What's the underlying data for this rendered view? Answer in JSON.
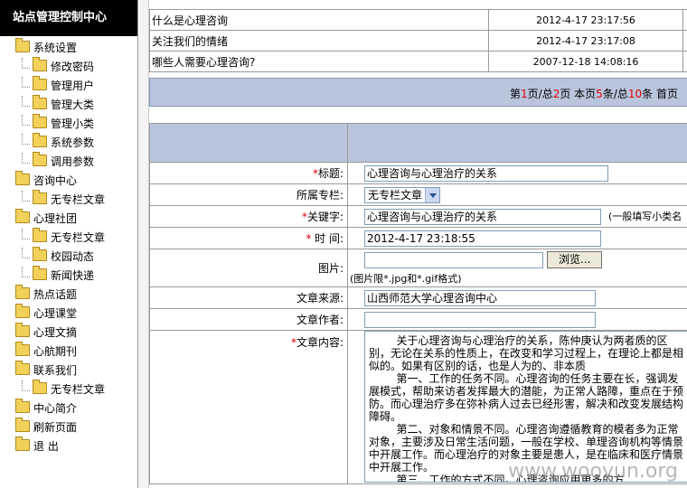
{
  "sidebar": {
    "title": "站点管理控制中心",
    "items": [
      {
        "label": "系统设置",
        "level": 0
      },
      {
        "label": "修改密码",
        "level": 1
      },
      {
        "label": "管理用户",
        "level": 1
      },
      {
        "label": "管理大类",
        "level": 1
      },
      {
        "label": "管理小类",
        "level": 1
      },
      {
        "label": "系统参数",
        "level": 1
      },
      {
        "label": "调用参数",
        "level": 1
      },
      {
        "label": "咨询中心",
        "level": 0
      },
      {
        "label": "无专栏文章",
        "level": 1
      },
      {
        "label": "心理社团",
        "level": 0
      },
      {
        "label": "无专栏文章",
        "level": 1
      },
      {
        "label": "校园动态",
        "level": 1
      },
      {
        "label": "新闻快递",
        "level": 1
      },
      {
        "label": "热点话题",
        "level": 0
      },
      {
        "label": "心理课堂",
        "level": 0
      },
      {
        "label": "心理文摘",
        "level": 0
      },
      {
        "label": "心航期刊",
        "level": 0
      },
      {
        "label": "联系我们",
        "level": 0
      },
      {
        "label": "无专栏文章",
        "level": 1
      },
      {
        "label": "中心简介",
        "level": 0
      },
      {
        "label": "刷新页面",
        "level": 0
      },
      {
        "label": "退 出",
        "level": 0
      }
    ]
  },
  "list": {
    "rows": [
      {
        "title": "什么是心理咨询",
        "date": "2012-4-17 23:17:56"
      },
      {
        "title": "关注我们的情绪",
        "date": "2012-4-17 23:17:08"
      },
      {
        "title": "哪些人需要心理咨询?",
        "date": "2007-12-18 14:08:16"
      }
    ]
  },
  "pager": {
    "p1": "第",
    "cur": "1",
    "p2": "页/总",
    "total": "2",
    "p3": "页 本页",
    "per": "5",
    "p4": "条/总",
    "count": "10",
    "p5": "条 首页"
  },
  "form": {
    "title_label": "标题:",
    "title_value": "心理咨询与心理治疗的关系",
    "column_label": "所属专栏:",
    "column_value": "无专栏文章",
    "keyword_label": "关键字:",
    "keyword_value": "心理咨询与心理治疗的关系",
    "keyword_hint": "(一般填写小类名",
    "time_label": "时 间:",
    "time_value": "2012-4-17 23:18:55",
    "image_label": "图片:",
    "browse_label": "浏览...",
    "image_hint": "(图片限*.jpg和*.gif格式)",
    "source_label": "文章来源:",
    "source_value": "山西师范大学心理咨询中心",
    "author_label": "文章作者:",
    "author_value": "",
    "content_label": "文章内容:",
    "content_value": "        关于心理咨询与心理治疗的关系，陈仲庚认为两者质的区别，无论在关系的性质上，在改变和学习过程上，在理论上都是相似的。如果有区别的话，也是人为的、非本质\n        第一、工作的任务不同。心理咨询的任务主要在长，强调发展模式，帮助来访者发挥最大的潜能，为正常人路障，重点在于预防。而心理治疗多在弥补病人过去已经形害，解决和改变发展结构障碍。\n        第二、对象和情景不同。心理咨询遵循教育的模者多为正常对象，主要涉及日常生活问题，一般在学校、单理咨询机构等情景中开展工作。而心理治疗的对象主要是患人，是在临床和医疗情景中开展工作。\n        第三、工作的方式不同。心理咨询应用更多的方"
  },
  "watermark": "www.wooyun.org"
}
